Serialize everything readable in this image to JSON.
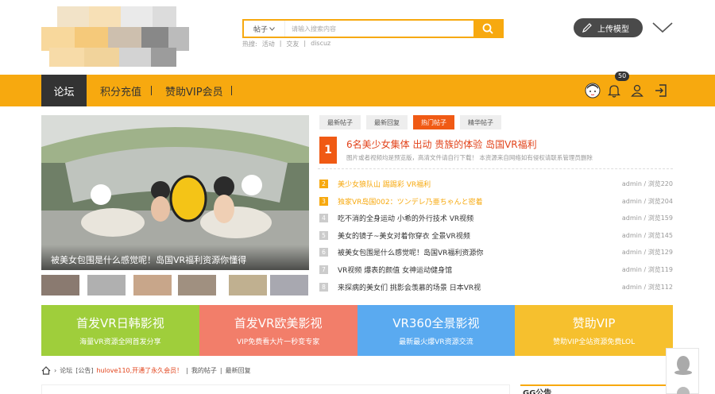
{
  "search": {
    "category": "帖子",
    "placeholder": "请输入搜索内容"
  },
  "hot": {
    "label": "热搜:",
    "items": [
      "活动",
      "交友",
      "discuz"
    ]
  },
  "header": {
    "upload_label": "上传模型"
  },
  "nav": {
    "items": [
      "论坛",
      "积分充值",
      "赞助VIP会员"
    ],
    "notification_count": "50"
  },
  "slider": {
    "caption": "被美女包围是什么感觉呢！岛国VR福利资源你懂得"
  },
  "tabs": [
    "最新帖子",
    "最新回复",
    "热门帖子",
    "精华帖子"
  ],
  "featured": {
    "number": "1",
    "title": "6名美少女集体 出动 贵族的体验 岛国VR福利",
    "desc": "图片或者视频均是预览版，高清文件请自行下载！ 本资源来自网络如有侵权请联系管理员删除"
  },
  "posts": [
    {
      "num": "2",
      "title": "美少女狼队山 踢踢彩 VR福利",
      "meta": "admin / 浏览220",
      "highlight": true,
      "color": "#f7a90f"
    },
    {
      "num": "3",
      "title": "独家VR岛国002：ツンデレ乃亜ちゃんと密着",
      "meta": "admin / 浏览204",
      "highlight": true,
      "color": "#f7a90f"
    },
    {
      "num": "4",
      "title": "吃不消的全身运动 小希的外行技术 VR视频",
      "meta": "admin / 浏览159",
      "highlight": false
    },
    {
      "num": "5",
      "title": "美女的镜子~美女对着你穿衣 全景VR视频",
      "meta": "admin / 浏览145",
      "highlight": false
    },
    {
      "num": "6",
      "title": "被美女包围是什么感觉呢！岛国VR福利资源你",
      "meta": "admin / 浏览129",
      "highlight": false
    },
    {
      "num": "7",
      "title": "VR视频 爆表的颜值 女神运动健身馆",
      "meta": "admin / 浏览119",
      "highlight": false
    },
    {
      "num": "8",
      "title": "来探病的美女们 挑影会羡慕的场景 日本VR视",
      "meta": "admin / 浏览112",
      "highlight": false
    }
  ],
  "blocks": [
    {
      "title": "首发VR日韩影视",
      "sub": "海量VR资源全网首发分享",
      "color": "#9fce3b"
    },
    {
      "title": "首发VR欧美影视",
      "sub": "VIP免费看大片一秒变专家",
      "color": "#f27e6a"
    },
    {
      "title": "VR360全景影视",
      "sub": "最新最火爆VR资源交流",
      "color": "#5aaaf0"
    },
    {
      "title": "赞助VIP",
      "sub": "赞助VIP全站资源免费LOL",
      "color": "#f6c02e"
    }
  ],
  "breadcrumb": {
    "home": "论坛",
    "notice_label": "[公告]",
    "notice": "hulove110,开通了永久会员！",
    "links": [
      "我的帖子",
      "最新回复"
    ]
  },
  "sidebar": {
    "title": "GG公告"
  }
}
